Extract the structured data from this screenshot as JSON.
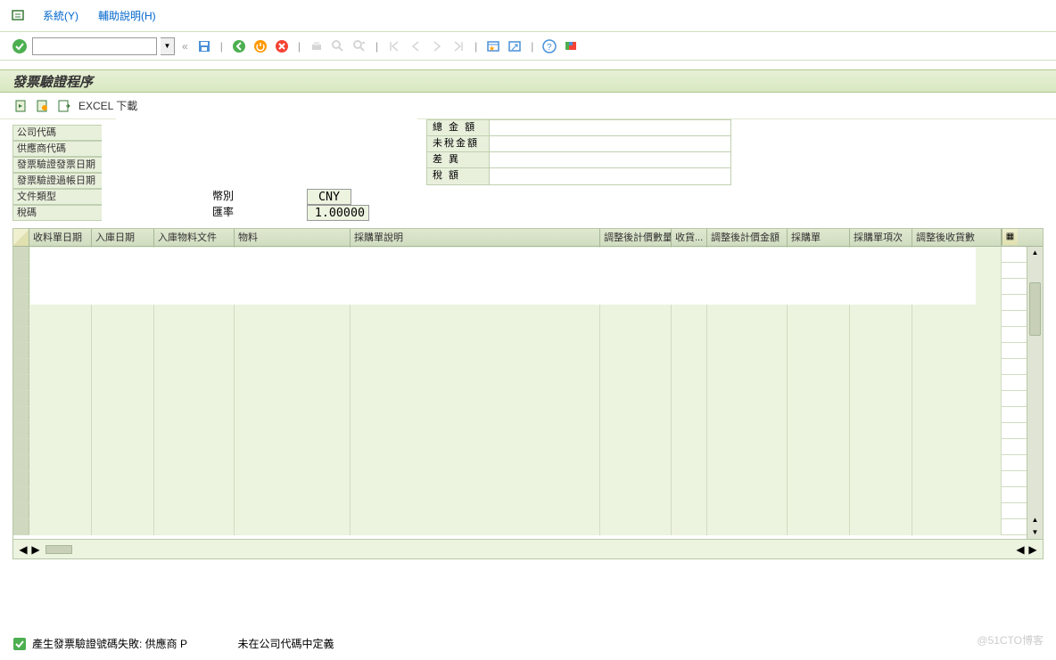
{
  "menu": {
    "system": "系統(Y)",
    "help": "輔助說明(H)"
  },
  "toolbar": {
    "cmd_value": "",
    "icons": {
      "check": "green-check",
      "save": "save",
      "back": "back",
      "exit": "exit",
      "cancel": "cancel",
      "print": "print",
      "find": "find",
      "findnext": "find-next",
      "nav1": "first",
      "nav2": "prev",
      "nav3": "next",
      "nav4": "last",
      "new": "new-session",
      "link": "shortcut",
      "help": "help",
      "layout": "layout"
    }
  },
  "title": "發票驗證程序",
  "subtoolbar": {
    "btn1": "execute",
    "btn2": "get-variant",
    "btn3": "excel-export",
    "excel_label": "EXCEL 下載"
  },
  "form": {
    "labels": {
      "company": "公司代碼",
      "vendor": "供應商代碼",
      "inv_date": "發票驗證發票日期",
      "post_date": "發票驗證過帳日期",
      "doc_type": "文件類型",
      "tax_code": "稅碼",
      "currency": "幣別",
      "rate": "匯率"
    },
    "values": {
      "currency": "CNY",
      "rate": "1.00000"
    }
  },
  "summary": {
    "labels": {
      "total": "總 金 額",
      "net": "未稅金額",
      "diff": "差    異",
      "tax": "稅    額"
    }
  },
  "grid": {
    "columns": [
      "收料單日期",
      "入庫日期",
      "入庫物料文件",
      "物料",
      "採購單說明",
      "調整後計價數量",
      "收貨...",
      "調整後計價金額",
      "採購單",
      "採購單項次",
      "調整後收貨數"
    ]
  },
  "status": {
    "message_prefix": "產生發票驗證號碼失敗: 供應商 P",
    "message_suffix": "未在公司代碼中定義"
  },
  "watermark": "@51CTO博客"
}
